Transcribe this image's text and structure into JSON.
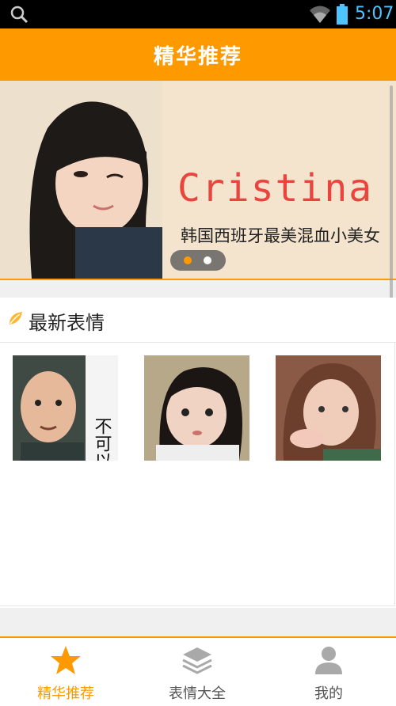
{
  "status_bar": {
    "time": "5:07"
  },
  "header": {
    "title": "精华推荐"
  },
  "banner": {
    "headline": "韩国西班牙最美混血小美女",
    "name": "Cristina"
  },
  "section": {
    "title": "最新表情"
  },
  "thumbnails": [
    {
      "caption": "不可以!!"
    },
    {
      "caption": ""
    },
    {
      "caption": ""
    }
  ],
  "tabs": [
    {
      "label": "精华推荐",
      "icon": "star-icon",
      "active": true
    },
    {
      "label": "表情大全",
      "icon": "layers-icon",
      "active": false
    },
    {
      "label": "我的",
      "icon": "user-icon",
      "active": false
    }
  ],
  "colors": {
    "accent": "#ff9900",
    "time": "#4ec3ff",
    "name": "#e8453f"
  }
}
